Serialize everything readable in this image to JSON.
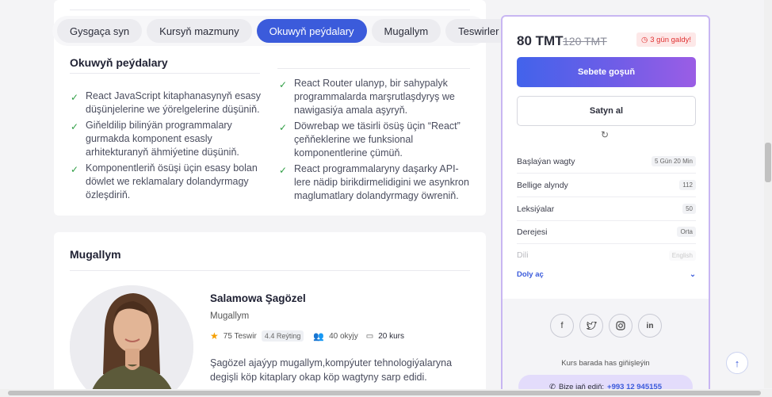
{
  "tabs": [
    {
      "label": "Gysgaça syn"
    },
    {
      "label": "Kursyň mazmuny"
    },
    {
      "label": "Okuwyň peýdalary"
    },
    {
      "label": "Mugallym"
    },
    {
      "label": "Teswirler"
    }
  ],
  "benefits": {
    "title": "Okuwyň peýdalary",
    "left": [
      "React JavaScript kitaphanasynyň esasy düşünjelerine we ýörelgelerine düşüniň.",
      "Giňeldilip bilinýän programmalary gurmakda komponent esasly arhitekturanyň ähmiýetine düşüniň.",
      "Komponentleriň ösüşi üçin esasy bolan döwlet we reklamalary dolandyrmagy özleşdiriň."
    ],
    "right": [
      "React Router ulanyp, bir sahypalyk programmalarda marşrutlaşdyryş we nawigasiýa amala aşyryň.",
      "Döwrebap we täsirli ösüş üçin “React” çeňňeklerine we funksional komponentlerine çümüň.",
      "React programmalaryny daşarky API-lere nädip birikdirmelidigini we asynkron maglumatlary dolandyrmagy öwreniň."
    ]
  },
  "teacher": {
    "section_title": "Mugallym",
    "name": "Salamowa Şagözel",
    "role": "Mugallym",
    "reviews": "75 Teswir",
    "rating": "4.4 Reýting",
    "students": "40 okyjy",
    "courses": "20 kurs",
    "description": "Şagözel ajaýyp mugallym,kompýuter tehnologiýalaryna degişli köp kitaplary okap köp wagtyny sarp edidi."
  },
  "sidebar": {
    "price": "80 TMT",
    "old_price": "120 TMT",
    "days_left": "3 gün galdy!",
    "add_to_cart": "Sebete goşuň",
    "buy": "Satyn al",
    "info": [
      {
        "label": "Başlaýan wagty",
        "value": "5 Gün 20 Min"
      },
      {
        "label": "Bellige alyndy",
        "value": "112"
      },
      {
        "label": "Leksiýalar",
        "value": "50"
      },
      {
        "label": "Derejesi",
        "value": "Orta"
      },
      {
        "label": "Dili",
        "value": "English"
      }
    ],
    "more": "Doly aç",
    "contact_text": "Kurs barada has giňişleýin",
    "phone_label": "Bize jaň ediň:",
    "phone": "+993 12 945155"
  },
  "colors": {
    "accent": "#3b5bdb",
    "check": "#2f9e44",
    "danger": "#e03131",
    "sidebar_border": "#c8b6f2"
  }
}
